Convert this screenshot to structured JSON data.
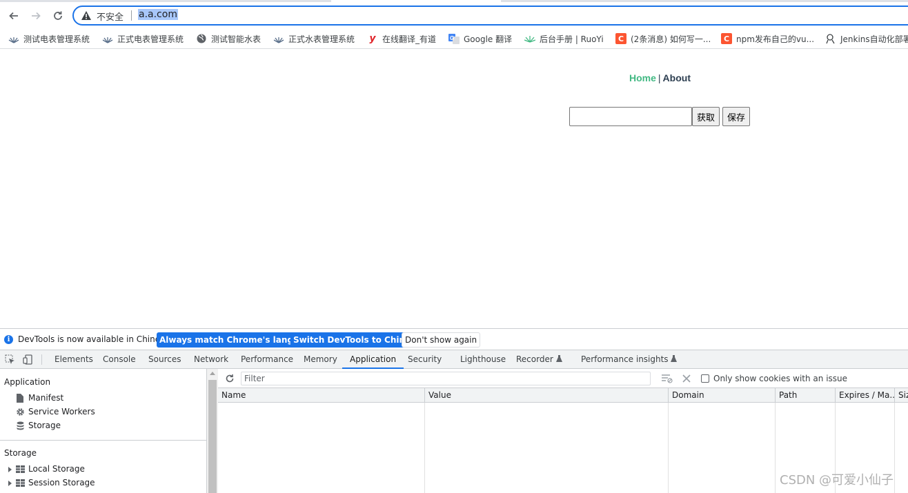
{
  "browser": {
    "security_label": "不安全",
    "url": "a.a.com",
    "bookmarks": [
      {
        "label": "测试电表管理系统",
        "icon": "plant-icon"
      },
      {
        "label": "正式电表管理系统",
        "icon": "plant-icon"
      },
      {
        "label": "测试智能水表",
        "icon": "globe-icon"
      },
      {
        "label": "正式水表管理系统",
        "icon": "plant-icon"
      },
      {
        "label": "在线翻译_有道",
        "icon": "youdao-icon"
      },
      {
        "label": "Google 翻译",
        "icon": "google-translate-icon"
      },
      {
        "label": "后台手册 | RuoYi",
        "icon": "ruoyi-icon"
      },
      {
        "label": "(2条消息) 如何写一...",
        "icon": "csdn-icon"
      },
      {
        "label": "npm发布自己的vu...",
        "icon": "csdn-icon"
      },
      {
        "label": "Jenkins自动化部署",
        "icon": "jenkins-icon"
      }
    ]
  },
  "page": {
    "nav_home": "Home",
    "nav_sep": "|",
    "nav_about": "About",
    "input_value": "",
    "get_button": "获取",
    "save_button": "保存"
  },
  "devtools": {
    "infobar": {
      "message": "DevTools is now available in Chinese!",
      "btn_match": "Always match Chrome's language",
      "btn_switch": "Switch DevTools to Chinese",
      "btn_dismiss": "Don't show again"
    },
    "tabs": [
      "Elements",
      "Console",
      "Sources",
      "Network",
      "Performance",
      "Memory",
      "Application",
      "Security",
      "Lighthouse",
      "Recorder",
      "Performance insights"
    ],
    "active_tab": "Application",
    "sidebar": {
      "application_header": "Application",
      "application_items": [
        "Manifest",
        "Service Workers",
        "Storage"
      ],
      "storage_header": "Storage",
      "storage_items": [
        "Local Storage",
        "Session Storage"
      ]
    },
    "cookies": {
      "filter_placeholder": "Filter",
      "only_issue_label": "Only show cookies with an issue",
      "columns": [
        "Name",
        "Value",
        "Domain",
        "Path",
        "Expires / Ma...",
        "Siz"
      ]
    }
  },
  "watermark": "CSDN @可爱小仙子",
  "colors": {
    "accent": "#1a73e8",
    "vue_green": "#42b983",
    "vue_dark": "#2c3e50"
  }
}
